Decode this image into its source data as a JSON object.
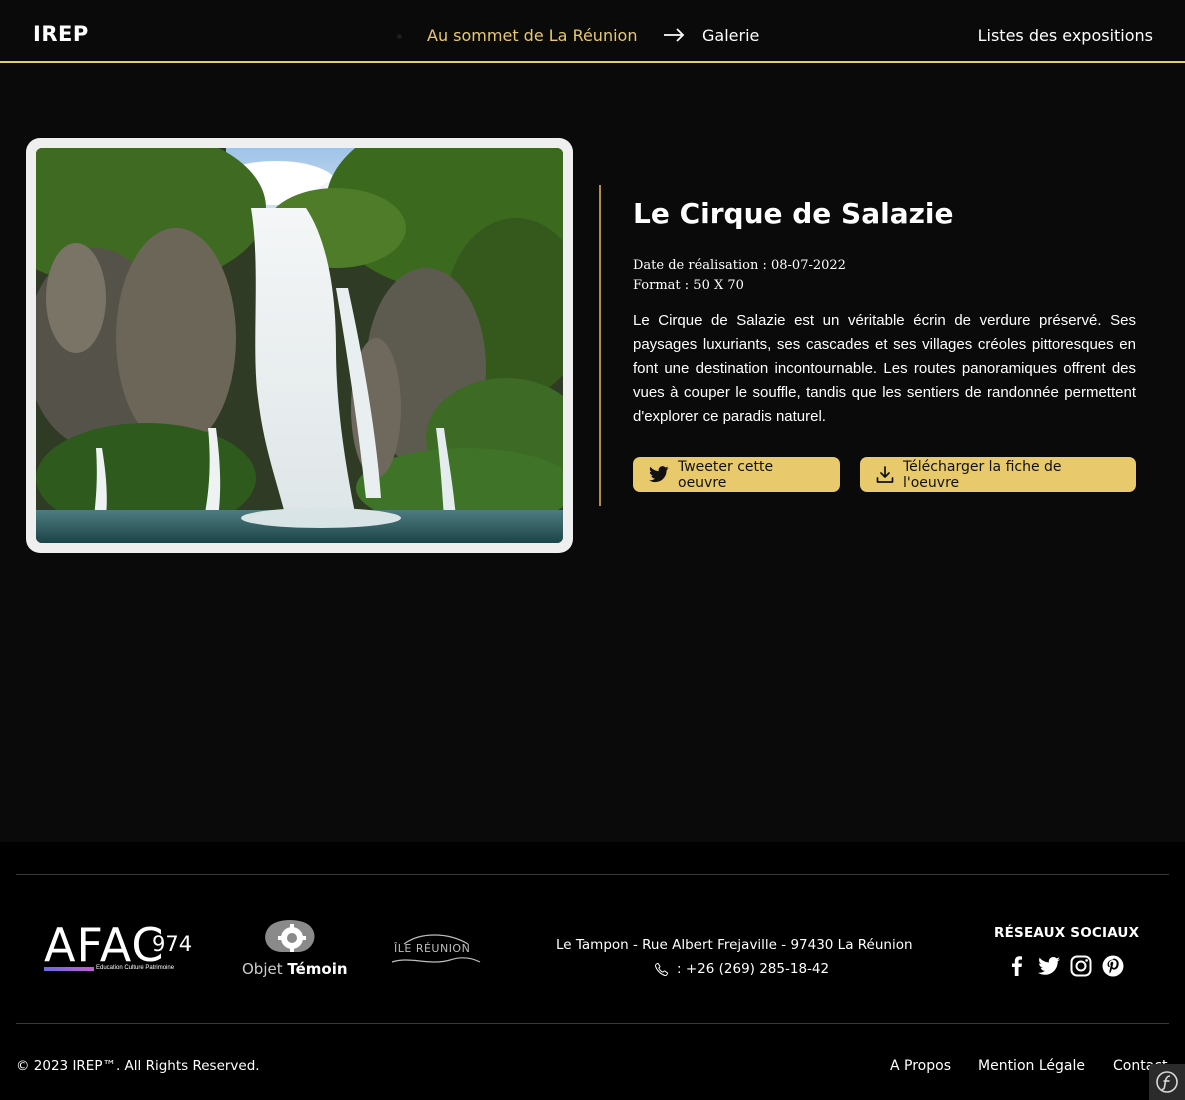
{
  "header": {
    "logo": "IREP",
    "breadcrumb_current": "Au sommet de La Réunion",
    "breadcrumb_next": "Galerie",
    "nav_right": "Listes des expositions"
  },
  "artwork": {
    "title": "Le Cirque de Salazie",
    "date_line": "Date de réalisation : 08-07-2022",
    "format_line": "Format : 50 X 70",
    "description": "Le Cirque de Salazie est un véritable écrin de verdure préservé. Ses paysages luxuriants, ses cascades et ses villages créoles pittoresques en font une destination incontournable. Les routes panoramiques offrent des vues à couper le souffle, tandis que les sentiers de randonnée permettent d'explorer ce paradis naturel.",
    "tweet_label": "Tweeter cette oeuvre",
    "download_label": "Télécharger la fiche de l'oeuvre"
  },
  "footer": {
    "logos": {
      "afac_main": "AFAC",
      "afac_num": "974",
      "afac_tagline": "Education Culture Patrimoine",
      "objet_light": "Objet ",
      "objet_bold": "Témoin",
      "ile": "ÎLE RÉUNION"
    },
    "address": "Le Tampon - Rue Albert Frejaville - 97430 La Réunion",
    "phone": ": +26 (269) 285-18-42",
    "social_title": "RÉSEAUX SOCIAUX",
    "social_icons": [
      "facebook-icon",
      "twitter-icon",
      "instagram-icon",
      "pinterest-icon"
    ],
    "copyright": "© 2023 IREP™. All Rights Reserved.",
    "links": [
      "A Propos",
      "Mention Légale",
      "Contact"
    ]
  },
  "colors": {
    "background": "#0a0a0b",
    "accent": "#e8c96b",
    "accent_dark": "#b58f3c",
    "footer_bg": "#000000"
  }
}
